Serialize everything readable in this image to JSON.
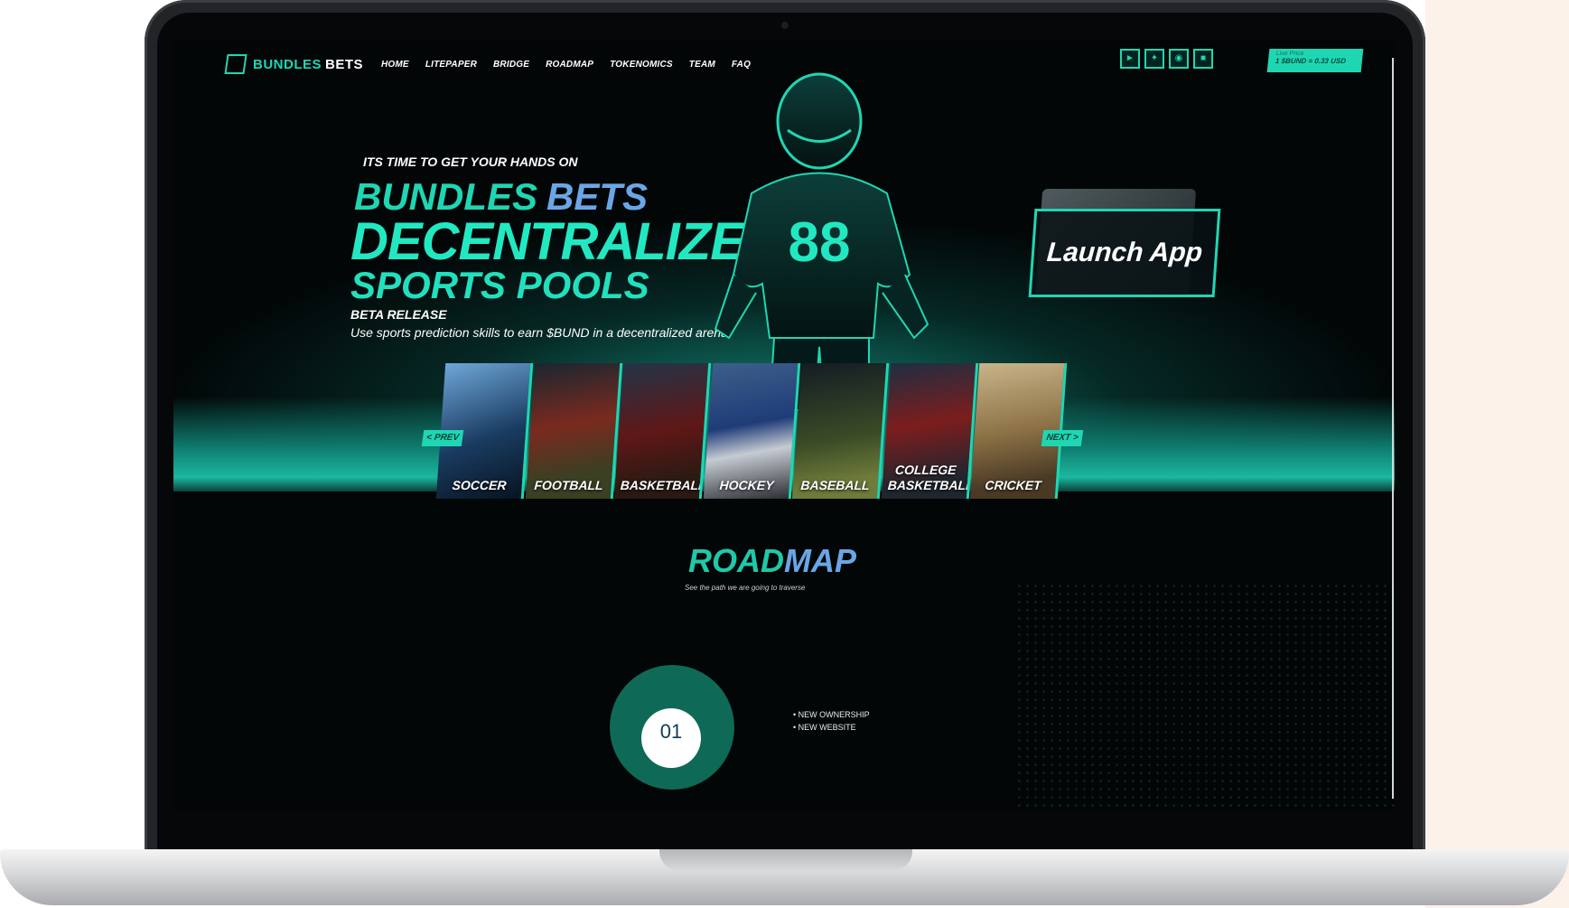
{
  "brand": {
    "name": "BUNDLES",
    "name2": "BETS"
  },
  "nav": [
    "HOME",
    "LITEPAPER",
    "BRIDGE",
    "ROADMAP",
    "TOKENOMICS",
    "TEAM",
    "FAQ"
  ],
  "socials": [
    "telegram-icon",
    "twitter-icon",
    "discord-icon",
    "medium-icon"
  ],
  "price": {
    "label": "Live Price",
    "value": "1 $BUND = 0.33 USD"
  },
  "hero": {
    "kicker": "ITS TIME TO GET YOUR HANDS ON",
    "line1": "BUNDLES",
    "line1_accent": "BETS",
    "line2": "DECENTRALIZED",
    "line3": "SPORTS POOLS",
    "beta": "BETA RELEASE",
    "subtitle": "Use sports prediction skills to earn $BUND in a decentralized arena",
    "jersey_number": "88"
  },
  "launch": {
    "label": "Launch App"
  },
  "sports": [
    "SOCCER",
    "FOOTBALL",
    "BASKETBALL",
    "HOCKEY",
    "BASEBALL",
    "COLLEGE BASKETBALL",
    "CRICKET"
  ],
  "carousel": {
    "prev": "< PREV",
    "next": "NEXT >"
  },
  "roadmap": {
    "title": "ROAD",
    "title_accent": "MAP",
    "subtitle": "See the path we are going to traverse",
    "phase": "01",
    "items": [
      "• NEW OWNERSHIP",
      "• NEW WEBSITE"
    ]
  },
  "colors": {
    "accent": "#1fd6b3",
    "accent_blue": "#6aa6e6",
    "bg": "#020607"
  }
}
